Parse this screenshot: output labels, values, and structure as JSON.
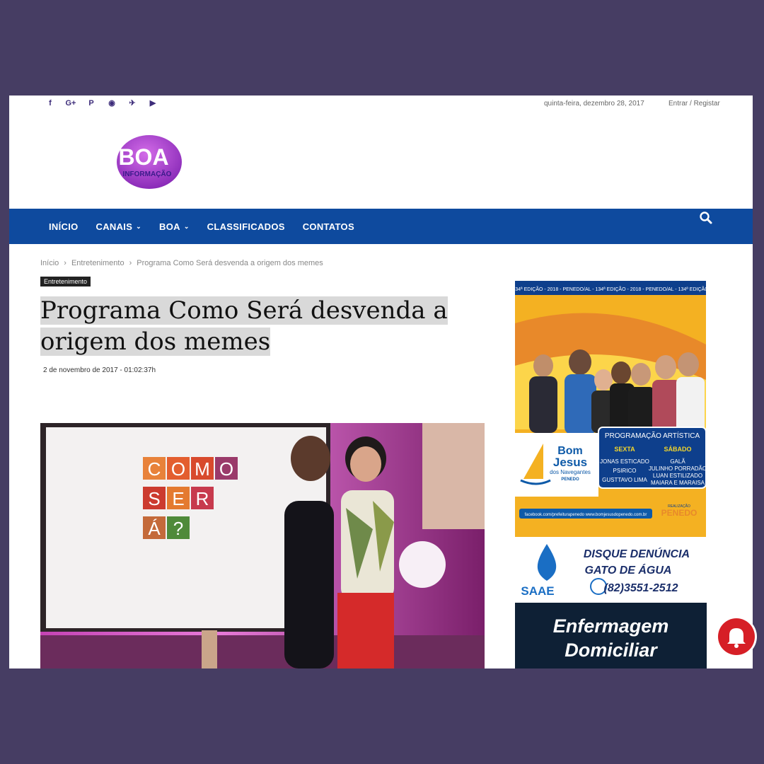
{
  "topbar": {
    "social_icons": [
      "facebook-icon",
      "google-plus-icon",
      "paypal-icon",
      "rss-icon",
      "twitter-icon",
      "youtube-icon"
    ],
    "social_glyphs": [
      "f",
      "G+",
      "P",
      "◉",
      "✈",
      "▶"
    ],
    "date": "quinta-feira, dezembro 28, 2017",
    "login": "Entrar / Registar"
  },
  "logo": {
    "text": "BOA",
    "sub": "INFORMAÇÃO"
  },
  "nav": {
    "items": [
      {
        "label": "INÍCIO",
        "dropdown": false
      },
      {
        "label": "CANAIS",
        "dropdown": true
      },
      {
        "label": "BOA",
        "dropdown": true
      },
      {
        "label": "CLASSIFICADOS",
        "dropdown": false
      },
      {
        "label": "CONTATOS",
        "dropdown": false
      }
    ],
    "search_icon": "search-icon"
  },
  "breadcrumb": [
    "Início",
    "Entretenimento",
    "Programa Como Será desvenda a origem dos memes"
  ],
  "breadcrumb_sep": "›",
  "article": {
    "category": "Entretenimento",
    "title_line1": "Programa Como Será desvenda a",
    "title_line2": "origem dos memes",
    "date": "2 de novembro de 2017 - 01:02:37h",
    "board_letters": [
      "C",
      "O",
      "M",
      "O",
      "S",
      "E",
      "R",
      "Á",
      "?"
    ]
  },
  "ads": {
    "festival": {
      "header": "134ª EDIÇÃO - 2018 - PENEDO/AL - 134ª EDIÇÃO - 2018 - PENEDO/AL - 134ª EDIÇÃO",
      "brand_line1": "Bom",
      "brand_line2": "Jesus",
      "brand_line3": "dos Navegantes",
      "brand_line4": "PENEDO",
      "prog_title": "PROGRAMAÇÃO ARTÍSTICA",
      "day1": "SEXTA",
      "day1_artists": [
        "JONAS ESTICADO",
        "PSIRICO",
        "GUSTTAVO LIMA"
      ],
      "day2": "SÁBADO",
      "day2_artists": [
        "GALÃ",
        "JULINHO PORRADÃO",
        "LUAN ESTILIZADO",
        "MAIARA E MARAISA"
      ],
      "footer_links": "facebook.com/prefeiturapenedo   www.bomjesusdopenedo.com.br",
      "realizacao": "REALIZAÇÃO",
      "city": "PENEDO"
    },
    "saae": {
      "logo": "SAAE",
      "line1": "DISQUE DENÚNCIA",
      "line2": "GATO DE ÁGUA",
      "phone": "(82)3551-2512"
    },
    "enfermagem": {
      "line1": "Enfermagem",
      "line2": "Domiciliar"
    }
  },
  "notification": {
    "icon": "bell-icon"
  }
}
